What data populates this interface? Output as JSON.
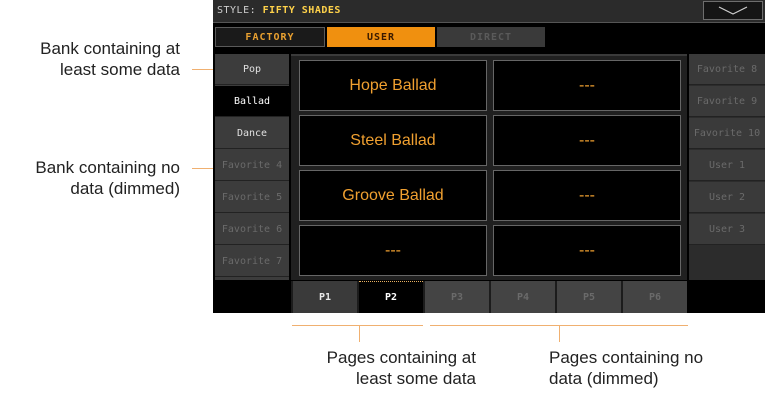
{
  "callouts": {
    "bank_with_data": [
      "Bank containing at",
      "least some data"
    ],
    "bank_no_data": [
      "Bank containing no",
      "data (dimmed)"
    ],
    "pages_with_data": [
      "Pages containing at",
      "least some data"
    ],
    "pages_no_data": [
      "Pages containing no",
      "data (dimmed)"
    ]
  },
  "screen": {
    "style_prefix": "STYLE:",
    "style_name": "FIFTY SHADES",
    "dropdown_icon": "chevron-down-icon",
    "tabs": [
      {
        "label": "FACTORY",
        "state": "normal"
      },
      {
        "label": "USER",
        "state": "selected"
      },
      {
        "label": "DIRECT",
        "state": "disabled"
      }
    ],
    "left_banks": [
      {
        "label": "Pop",
        "state": "has-data"
      },
      {
        "label": "Ballad",
        "state": "selected"
      },
      {
        "label": "Dance",
        "state": "has-data"
      },
      {
        "label": "Favorite 4",
        "state": "dim"
      },
      {
        "label": "Favorite 5",
        "state": "dim"
      },
      {
        "label": "Favorite 6",
        "state": "dim"
      },
      {
        "label": "Favorite 7",
        "state": "dim"
      }
    ],
    "right_banks": [
      {
        "label": "Favorite 8",
        "state": "dim"
      },
      {
        "label": "Favorite 9",
        "state": "dim"
      },
      {
        "label": "Favorite 10",
        "state": "dim"
      },
      {
        "label": "User 1",
        "state": "dim"
      },
      {
        "label": "User 2",
        "state": "dim"
      },
      {
        "label": "User 3",
        "state": "dim"
      }
    ],
    "slots": [
      [
        "Hope Ballad",
        "---"
      ],
      [
        "Steel Ballad",
        "---"
      ],
      [
        "Groove Ballad",
        "---"
      ],
      [
        "---",
        "---"
      ]
    ],
    "pages": [
      {
        "label": "P1",
        "state": "has-data"
      },
      {
        "label": "P2",
        "state": "selected"
      },
      {
        "label": "P3",
        "state": "dim"
      },
      {
        "label": "P4",
        "state": "dim"
      },
      {
        "label": "P5",
        "state": "dim"
      },
      {
        "label": "P6",
        "state": "dim"
      }
    ],
    "colors": {
      "accent": "#f0900f",
      "slot_text": "#f0a030",
      "callout_line": "#f0b070"
    }
  }
}
